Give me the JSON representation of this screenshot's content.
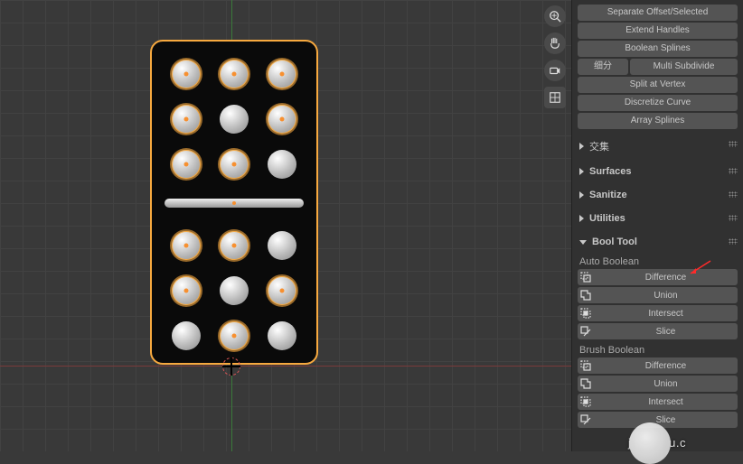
{
  "top_buttons": {
    "row0a": "Separate Offset/Selected",
    "row1": "Extend Handles",
    "row2": "Boolean Splines",
    "row3a": "细分",
    "row3b": "Multi Subdivide",
    "row4": "Split at Vertex",
    "row5": "Discretize Curve",
    "row6": "Array Splines"
  },
  "panels": {
    "jiaoji": "交集",
    "surfaces": "Surfaces",
    "sanitize": "Sanitize",
    "utilities": "Utilities",
    "booltool": "Bool Tool"
  },
  "booltool": {
    "auto_label": "Auto Boolean",
    "brush_label": "Brush Boolean",
    "difference": "Difference",
    "union": "Union",
    "intersect": "Intersect",
    "slice": "Slice"
  },
  "watermark": "jing        aidu.c"
}
